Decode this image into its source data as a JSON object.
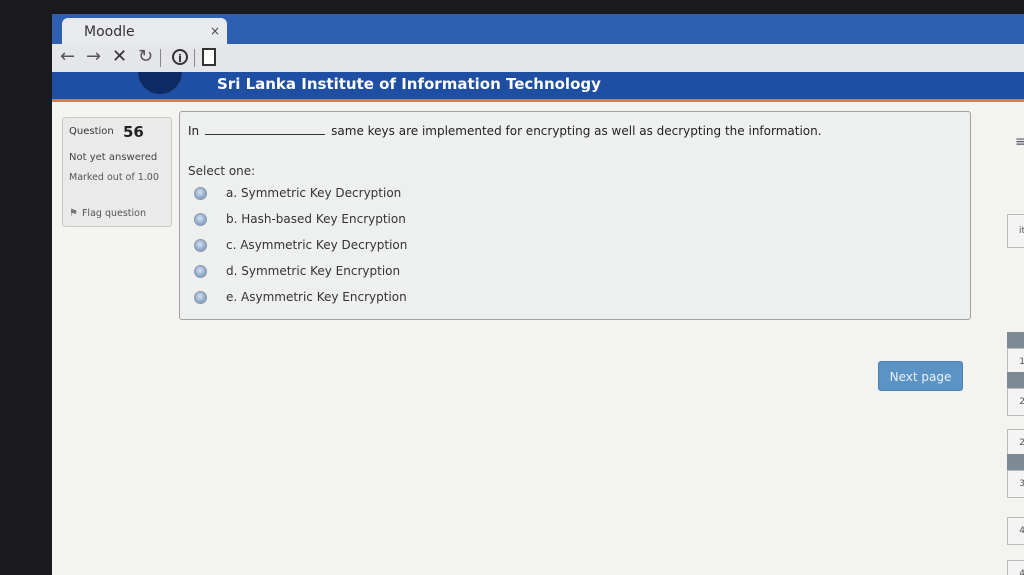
{
  "browser": {
    "tab_title": "Moodle",
    "tab_close": "×"
  },
  "banner": {
    "title": "Sri Lanka Institute of Information Technology"
  },
  "question_info": {
    "label": "Question",
    "number": "56",
    "status": "Not yet answered",
    "marked": "Marked out of 1.00",
    "flag_label": "Flag question"
  },
  "question": {
    "text_before": "In",
    "text_after": "same keys are implemented for encrypting as well as decrypting the information.",
    "prompt": "Select one:",
    "options": [
      "a. Symmetric Key Decryption",
      "b. Hash-based Key Encryption",
      "c. Asymmetric Key Decryption",
      "d. Symmetric Key Encryption",
      "e. Asymmetric Key Encryption"
    ]
  },
  "navigation": {
    "next_label": "Next page"
  },
  "side_panel": {
    "partial_text": "it",
    "quiz_nav_numbers": [
      "1",
      "2",
      "2",
      "3",
      "4",
      "4"
    ]
  },
  "icons": [
    "back-arrow-icon",
    "forward-arrow-icon",
    "stop-icon",
    "reload-icon",
    "info-icon",
    "page-icon",
    "flag-icon",
    "menu-icon"
  ]
}
